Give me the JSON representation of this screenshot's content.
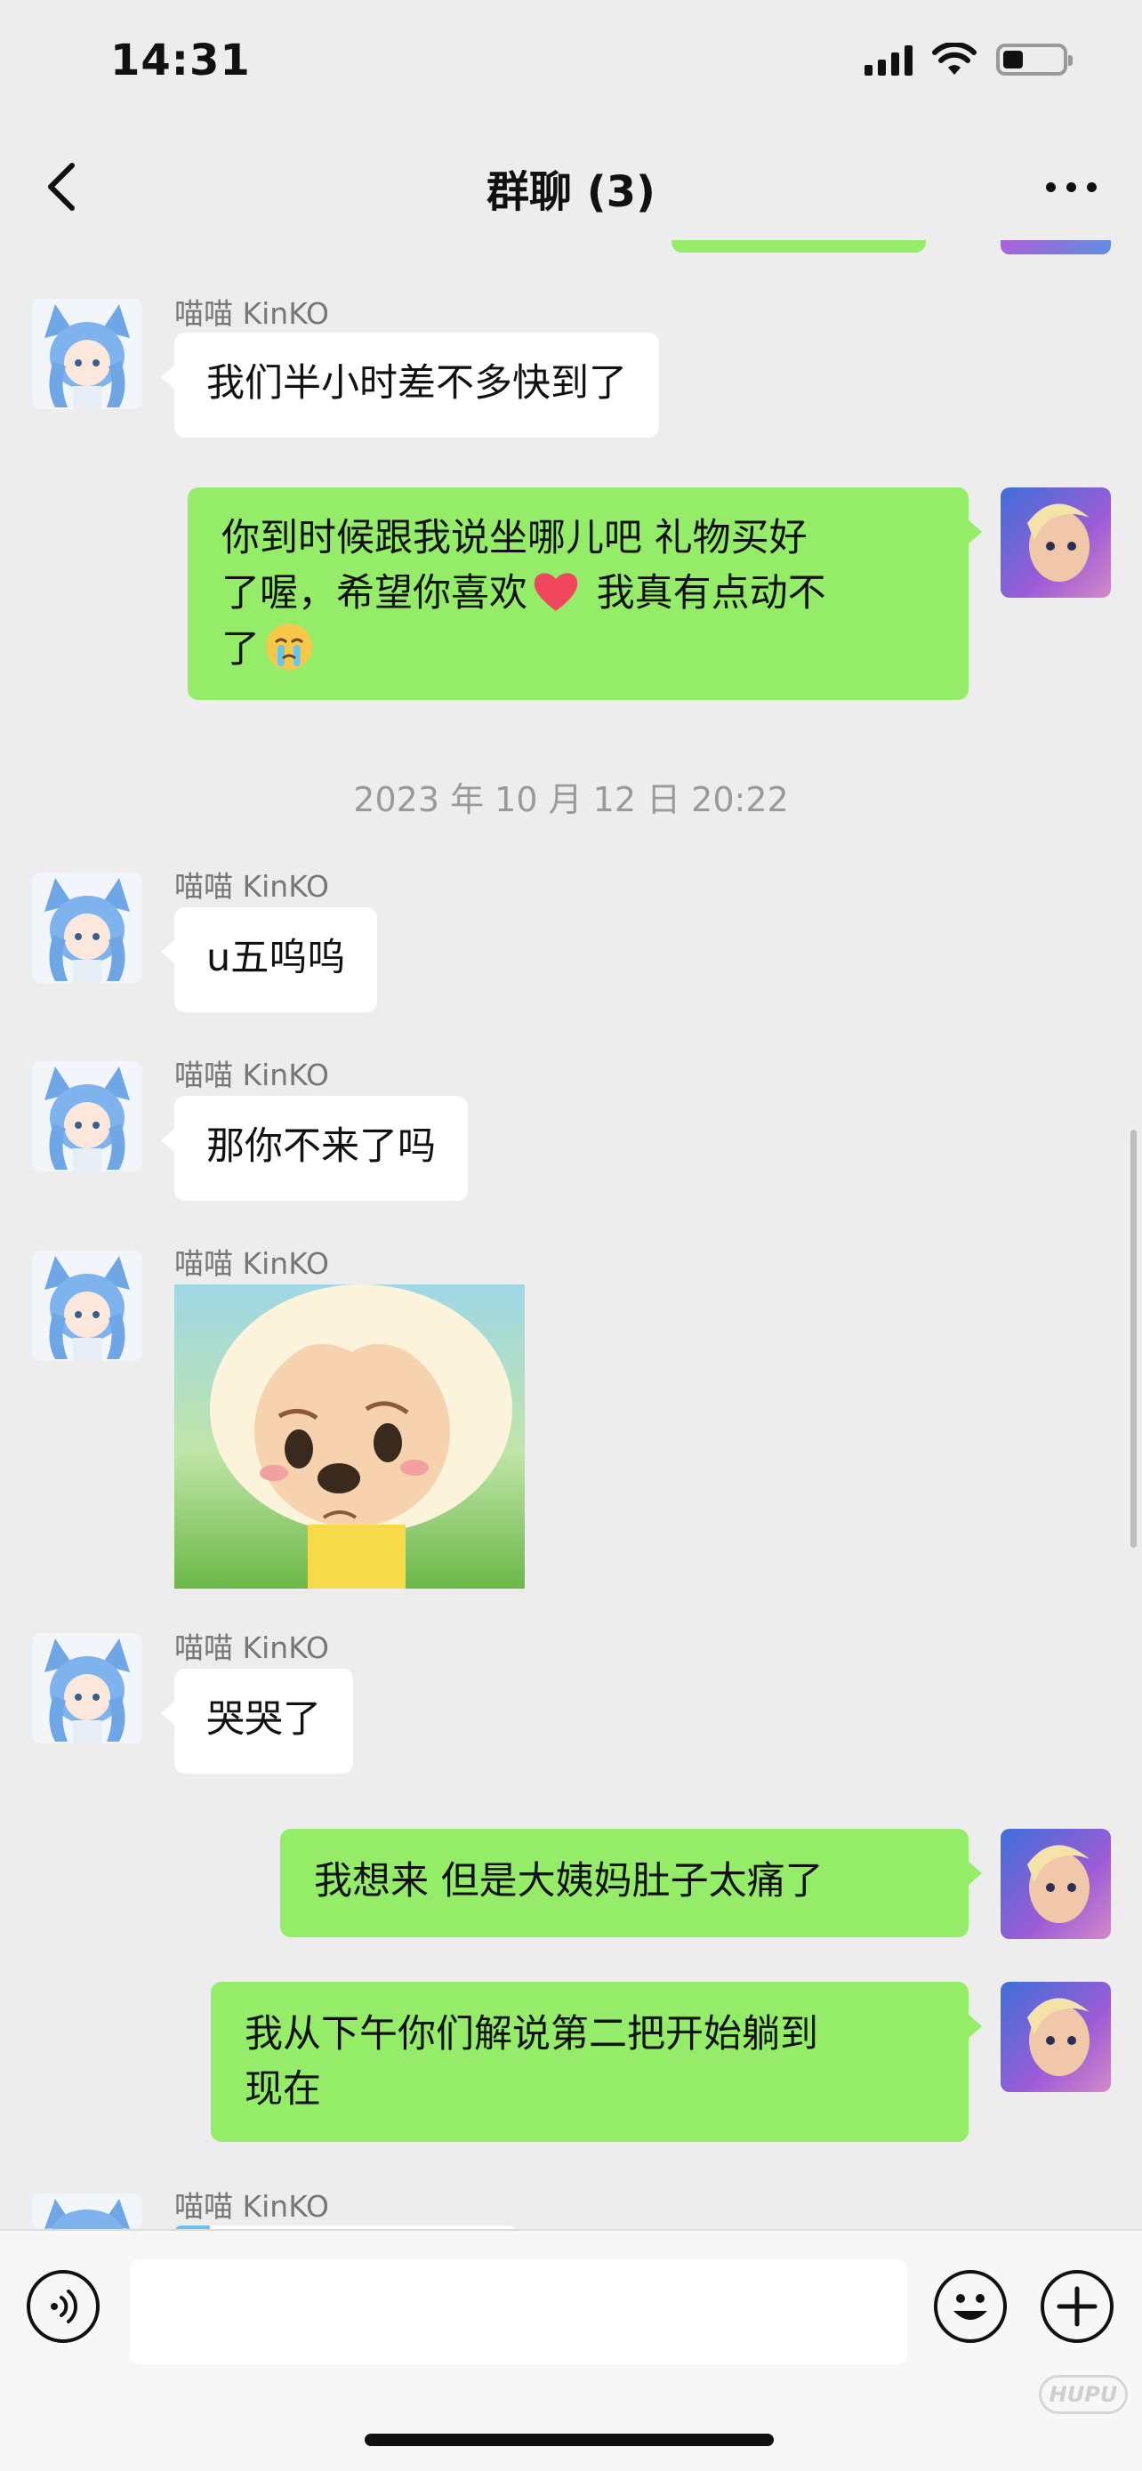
{
  "status_bar": {
    "time": "14:31"
  },
  "header": {
    "title": "群聊 (3)"
  },
  "messages": {
    "m1": {
      "sender": "喵喵 KinKO",
      "text": "我们半小时差不多快到了"
    },
    "m2": {
      "line1": "你到时候跟我说坐哪儿吧 礼物买好",
      "line2a": "了喔，希望你喜欢",
      "line2b": " 我真有点动不",
      "line3": "了"
    },
    "timestamp": "2023 年 10 月 12 日  20:22",
    "m3": {
      "sender": "喵喵 KinKO",
      "text": "u五呜呜"
    },
    "m4": {
      "sender": "喵喵 KinKO",
      "text": "那你不来了吗"
    },
    "m5": {
      "sender": "喵喵 KinKO"
    },
    "m6": {
      "sender": "喵喵 KinKO",
      "text": "哭哭了"
    },
    "m7": {
      "text": "我想来 但是大姨妈肚子太痛了"
    },
    "m8": {
      "line1": "我从下午你们解说第二把开始躺到",
      "line2": "现在"
    },
    "m9": {
      "sender": "喵喵 KinKO"
    }
  },
  "icons": {
    "back": "chevron-left-icon",
    "more": "more-dots-icon",
    "voice": "voice-icon",
    "emoji": "emoji-icon",
    "plus": "plus-icon",
    "heart": "heart-emoji-icon",
    "cry": "cry-emoji-icon"
  },
  "watermark": "HUPU",
  "colors": {
    "background": "#ededed",
    "bubble_right": "#95ec69",
    "bubble_left": "#ffffff",
    "secondary_text": "#777777"
  },
  "status": {
    "battery_level": 0.35
  }
}
